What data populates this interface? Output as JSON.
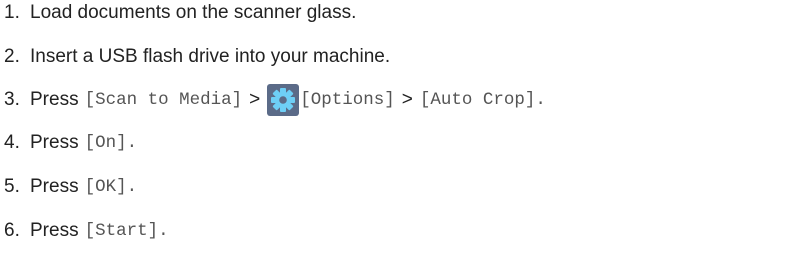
{
  "steps": [
    {
      "number": "1.",
      "text": "Load documents on the scanner glass."
    },
    {
      "number": "2.",
      "text": "Insert a USB flash drive into your machine."
    },
    {
      "number": "3.",
      "verb": "Press",
      "btn1": "[Scan to Media]",
      "sep1": ">",
      "icon": "gear-icon",
      "btn2": "[Options]",
      "sep2": ">",
      "btn3": "[Auto Crop]."
    },
    {
      "number": "4.",
      "verb": "Press",
      "btn": "[On]."
    },
    {
      "number": "5.",
      "verb": "Press",
      "btn": "[OK]."
    },
    {
      "number": "6.",
      "verb": "Press",
      "btn": "[Start]."
    }
  ],
  "colors": {
    "text": "#222222",
    "mono_text": "#555555",
    "icon_bg": "#5b6b88",
    "icon_fg": "#6ecff6"
  }
}
